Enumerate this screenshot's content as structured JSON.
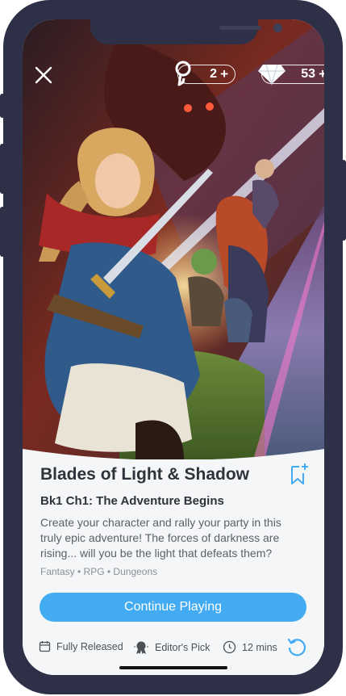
{
  "hud": {
    "keys_count": "2",
    "gems_count": "53",
    "plus": "+"
  },
  "story": {
    "title": "Blades of Light & Shadow",
    "chapter": "Bk1 Ch1: The Adventure Begins",
    "description": "Create your character and rally your party in this truly epic adventure! The forces of darkness are rising... will you be the light that defeats them?",
    "tags": "Fantasy • RPG • Dungeons"
  },
  "cta_label": "Continue Playing",
  "meta": {
    "status": "Fully Released",
    "badge": "Editor's Pick",
    "duration": "12 mins"
  },
  "colors": {
    "accent": "#42abf1",
    "frame": "#2e3048"
  },
  "icons": [
    "close-icon",
    "key-icon",
    "gem-icon",
    "bookmark-add-icon",
    "calendar-icon",
    "award-icon",
    "clock-icon",
    "restart-icon"
  ]
}
